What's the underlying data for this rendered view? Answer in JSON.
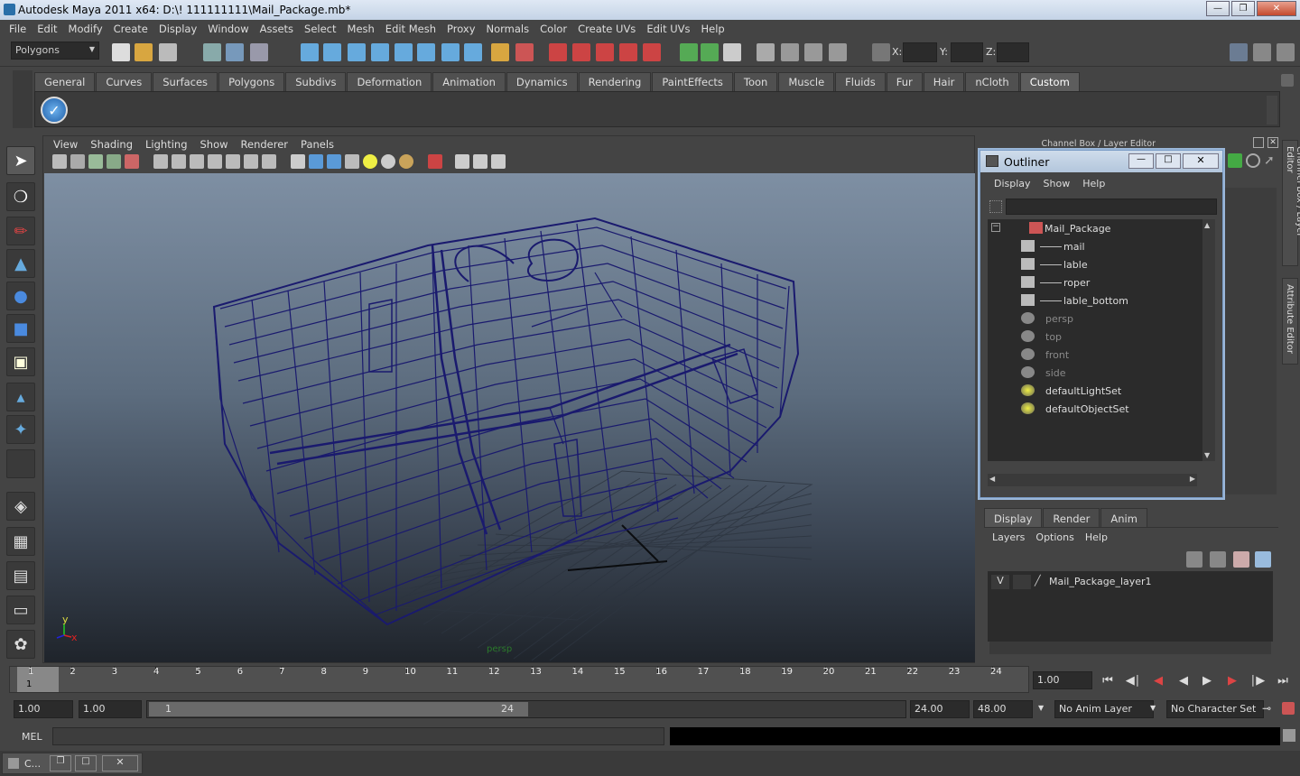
{
  "window": {
    "title": "Autodesk Maya 2011 x64: D:\\! 111111111\\Mail_Package.mb*"
  },
  "menubar": [
    "File",
    "Edit",
    "Modify",
    "Create",
    "Display",
    "Window",
    "Assets",
    "Select",
    "Mesh",
    "Edit Mesh",
    "Proxy",
    "Normals",
    "Color",
    "Create UVs",
    "Edit UVs",
    "Help"
  ],
  "status": {
    "mode": "Polygons",
    "x_label": "X:",
    "y_label": "Y:",
    "z_label": "Z:"
  },
  "shelf_tabs": [
    "General",
    "Curves",
    "Surfaces",
    "Polygons",
    "Subdivs",
    "Deformation",
    "Animation",
    "Dynamics",
    "Rendering",
    "PaintEffects",
    "Toon",
    "Muscle",
    "Fluids",
    "Fur",
    "Hair",
    "nCloth",
    "Custom"
  ],
  "shelf_active": "Custom",
  "viewport_menu": [
    "View",
    "Shading",
    "Lighting",
    "Show",
    "Renderer",
    "Panels"
  ],
  "viewport": {
    "camera_label": "persp",
    "axis_y": "y",
    "axis_x": "x",
    "wire_color": "#1a1a6e"
  },
  "channel_box": {
    "title": "Channel Box / Layer Editor"
  },
  "side_tabs": {
    "channel": "Channel Box / Layer Editor",
    "attribute": "Attribute Editor"
  },
  "outliner": {
    "title": "Outliner",
    "menu": [
      "Display",
      "Show",
      "Help"
    ],
    "items": [
      {
        "label": "Mail_Package",
        "icon": "group-icon",
        "depth": 0,
        "dim": false
      },
      {
        "label": "mail",
        "icon": "mesh-icon",
        "depth": 1,
        "dim": false
      },
      {
        "label": "lable",
        "icon": "mesh-icon",
        "depth": 1,
        "dim": false
      },
      {
        "label": "roper",
        "icon": "mesh-icon",
        "depth": 1,
        "dim": false
      },
      {
        "label": "lable_bottom",
        "icon": "mesh-icon",
        "depth": 1,
        "dim": false
      },
      {
        "label": "persp",
        "icon": "camera-icon",
        "depth": 0,
        "dim": true
      },
      {
        "label": "top",
        "icon": "camera-icon",
        "depth": 0,
        "dim": true
      },
      {
        "label": "front",
        "icon": "camera-icon",
        "depth": 0,
        "dim": true
      },
      {
        "label": "side",
        "icon": "camera-icon",
        "depth": 0,
        "dim": true
      },
      {
        "label": "defaultLightSet",
        "icon": "set-icon",
        "depth": 0,
        "dim": false
      },
      {
        "label": "defaultObjectSet",
        "icon": "set-icon",
        "depth": 0,
        "dim": false
      }
    ]
  },
  "layers": {
    "tabs": [
      "Display",
      "Render",
      "Anim"
    ],
    "menu": [
      "Layers",
      "Options",
      "Help"
    ],
    "row": {
      "visible": "V",
      "name": "Mail_Package_layer1"
    }
  },
  "timeline": {
    "ticks": [
      "1",
      "2",
      "3",
      "4",
      "5",
      "6",
      "7",
      "8",
      "9",
      "10",
      "11",
      "12",
      "13",
      "14",
      "15",
      "16",
      "17",
      "18",
      "19",
      "20",
      "21",
      "22",
      "23",
      "24"
    ],
    "current_frame_marker": "1",
    "current_time": "1.00"
  },
  "range": {
    "start": "1.00",
    "playback_start": "1.00",
    "slider_start": "1",
    "slider_end": "24",
    "playback_end": "24.00",
    "end": "48.00",
    "anim_layer": "No Anim Layer",
    "character_set": "No Character Set"
  },
  "cmdline": {
    "label": "MEL"
  },
  "taskbar": {
    "item": "C..."
  }
}
